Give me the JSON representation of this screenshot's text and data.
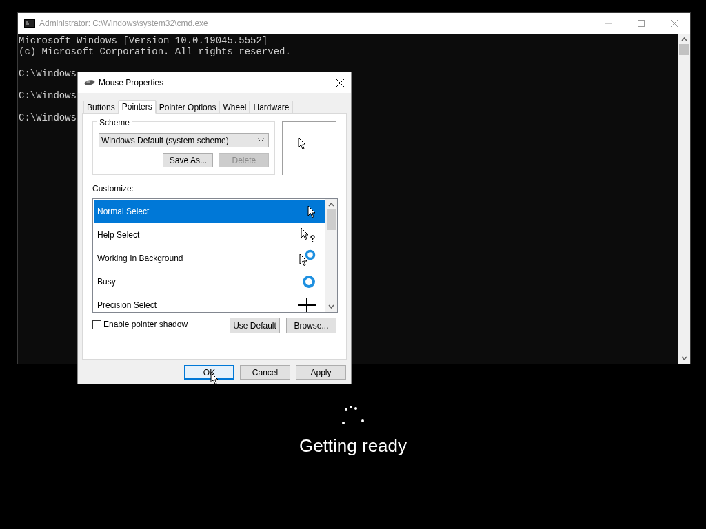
{
  "console": {
    "title": "Administrator: C:\\Windows\\system32\\cmd.exe",
    "blocks": [
      [
        "Microsoft Windows [Version 10.0.19045.5552]",
        "(c) Microsoft Corporation. All rights reserved."
      ],
      [
        "C:\\Windows"
      ],
      [
        "C:\\Windows"
      ],
      [
        "C:\\Windows"
      ]
    ]
  },
  "dialog": {
    "title": "Mouse Properties",
    "tabs": [
      {
        "label": "Buttons",
        "selected": false
      },
      {
        "label": "Pointers",
        "selected": true
      },
      {
        "label": "Pointer Options",
        "selected": false
      },
      {
        "label": "Wheel",
        "selected": false
      },
      {
        "label": "Hardware",
        "selected": false
      }
    ],
    "scheme": {
      "label": "Scheme",
      "value": "Windows Default (system scheme)",
      "buttons": [
        {
          "label": "Save As...",
          "disabled": false
        },
        {
          "label": "Delete",
          "disabled": true
        }
      ]
    },
    "customize_label": "Customize:",
    "pointers": [
      {
        "name": "Normal Select",
        "kind": "arrow",
        "selected": true
      },
      {
        "name": "Help Select",
        "kind": "help",
        "selected": false
      },
      {
        "name": "Working In Background",
        "kind": "working",
        "selected": false
      },
      {
        "name": "Busy",
        "kind": "busy",
        "selected": false
      },
      {
        "name": "Precision Select",
        "kind": "cross",
        "selected": false
      }
    ],
    "shadow": {
      "label": "Enable pointer shadow",
      "checked": false
    },
    "list_buttons": [
      {
        "label": "Use Default",
        "disabled": false
      },
      {
        "label": "Browse...",
        "disabled": false
      }
    ],
    "footer_buttons": [
      {
        "label": "OK",
        "default": true
      },
      {
        "label": "Cancel",
        "default": false
      },
      {
        "label": "Apply",
        "default": false
      }
    ]
  },
  "status": {
    "text": "Getting ready"
  }
}
